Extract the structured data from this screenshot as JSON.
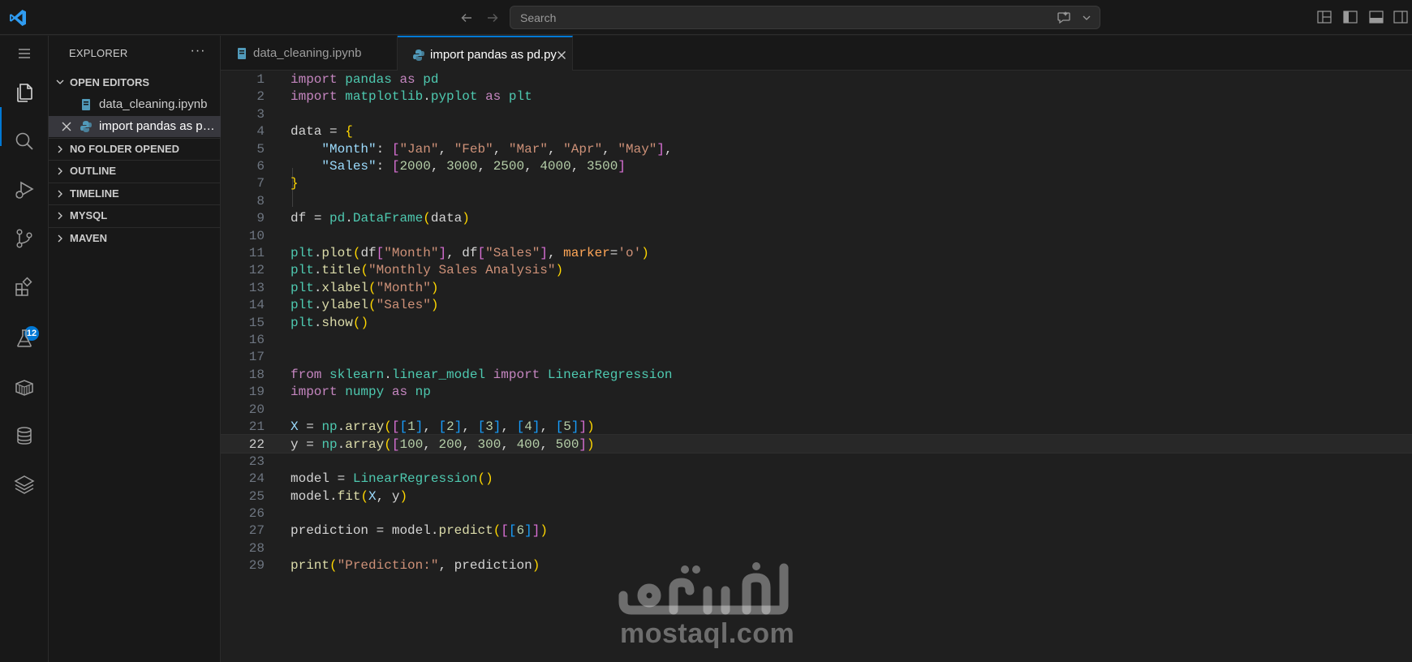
{
  "titlebar": {
    "search_placeholder": "Search"
  },
  "activity_bar": {
    "extensions_badge": "12"
  },
  "sidebar": {
    "title": "EXPLORER",
    "open_editors_label": "OPEN EDITORS",
    "open_editors": [
      {
        "name": "data_cleaning.ipynb",
        "type": "notebook"
      },
      {
        "name": "import pandas as pd.py",
        "type": "python"
      }
    ],
    "sections": [
      {
        "label": "NO FOLDER OPENED"
      },
      {
        "label": "OUTLINE"
      },
      {
        "label": "TIMELINE"
      },
      {
        "label": "MYSQL"
      },
      {
        "label": "MAVEN"
      }
    ]
  },
  "tabs": [
    {
      "label": "data_cleaning.ipynb",
      "active": false
    },
    {
      "label": "import pandas as pd.py",
      "active": true
    }
  ],
  "editor": {
    "current_line": 22,
    "line_numbers": [
      "1",
      "2",
      "3",
      "4",
      "5",
      "6",
      "7",
      "8",
      "9",
      "10",
      "11",
      "12",
      "13",
      "14",
      "15",
      "16",
      "17",
      "18",
      "19",
      "20",
      "21",
      "22",
      "23",
      "24",
      "25",
      "26",
      "27",
      "28",
      "29"
    ],
    "lines": [
      "import pandas as pd",
      "import matplotlib.pyplot as plt",
      "",
      "data = {",
      "    \"Month\": [\"Jan\", \"Feb\", \"Mar\", \"Apr\", \"May\"],",
      "    \"Sales\": [2000, 3000, 2500, 4000, 3500]",
      "}",
      "",
      "df = pd.DataFrame(data)",
      "",
      "plt.plot(df[\"Month\"], df[\"Sales\"], marker='o')",
      "plt.title(\"Monthly Sales Analysis\")",
      "plt.xlabel(\"Month\")",
      "plt.ylabel(\"Sales\")",
      "plt.show()",
      "",
      "",
      "from sklearn.linear_model import LinearRegression",
      "import numpy as np",
      "",
      "X = np.array([[1], [2], [3], [4], [5]])",
      "y = np.array([100, 200, 300, 400, 500])",
      "",
      "model = LinearRegression()",
      "model.fit(X, y)",
      "",
      "prediction = model.predict([[6]])",
      "",
      "print(\"Prediction:\", prediction)"
    ]
  },
  "watermark": {
    "arabic": "مستقل",
    "latin": "mostaql.com"
  },
  "colors": {
    "accent": "#0078d4",
    "keyword": "#c586c0",
    "module": "#4ec9b0",
    "string": "#ce9178",
    "function": "#dcdcaa"
  }
}
